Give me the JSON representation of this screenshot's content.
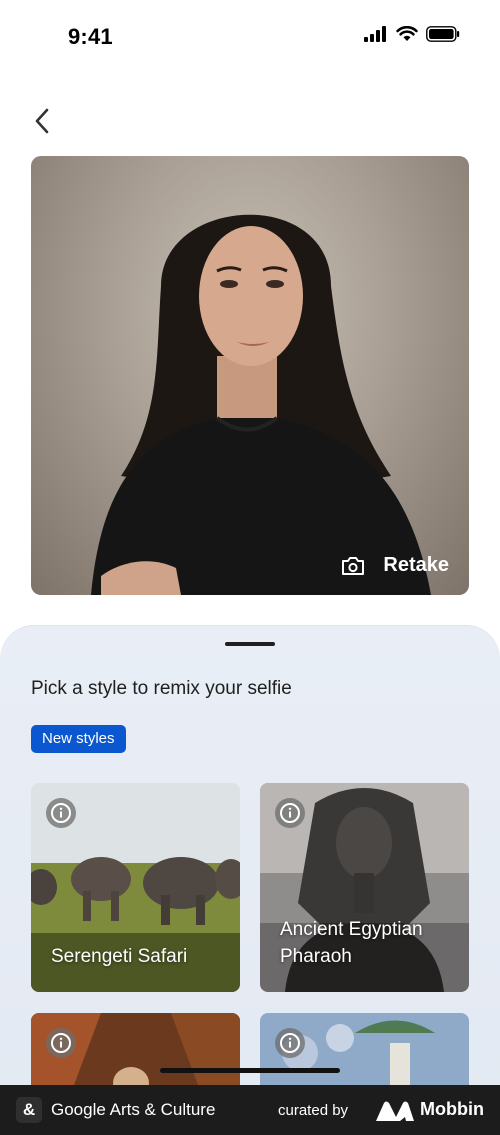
{
  "status_bar": {
    "time": "9:41"
  },
  "selfie": {
    "retake_label": "Retake"
  },
  "sheet": {
    "title": "Pick a style to remix your selfie",
    "chip": "New styles",
    "styles": [
      {
        "label": "Serengeti Safari"
      },
      {
        "label_line1": "Ancient Egyptian",
        "label_line2": "Pharaoh"
      }
    ]
  },
  "footer": {
    "app_name": "Google Arts & Culture",
    "curated_by": "curated by",
    "brand": "Mobbin"
  },
  "icons": [
    "back-chevron-icon",
    "camera-icon",
    "info-icon",
    "signal-icon",
    "wifi-icon",
    "battery-icon"
  ],
  "colors": {
    "chip": "#0b57d0",
    "footer": "#1c1c1c",
    "sheet": "#e9eef6"
  }
}
